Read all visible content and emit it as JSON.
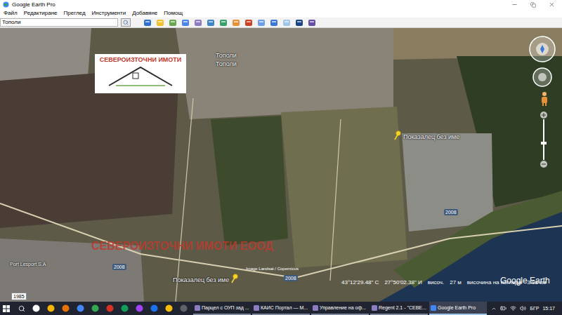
{
  "window": {
    "title": "Google Earth Pro"
  },
  "menu": [
    {
      "label": "Файл"
    },
    {
      "label": "Редактиране"
    },
    {
      "label": "Преглед"
    },
    {
      "label": "Инструменти"
    },
    {
      "label": "Добавяне"
    },
    {
      "label": "Помощ"
    }
  ],
  "search": {
    "value": "Тополи"
  },
  "map": {
    "logo": {
      "text": "СЕВЕРОИЗТОЧНИ ИМОТИ"
    },
    "place_labels": [
      {
        "text": "Тополи"
      },
      {
        "text": "Тополи"
      }
    ],
    "placemarks": [
      {
        "label": "Показалец без име"
      },
      {
        "label": "Показалец без име"
      }
    ],
    "road_labels": [
      {
        "text": "2008"
      },
      {
        "text": "2008"
      },
      {
        "text": "2008"
      }
    ],
    "watermark": "СЕВЕРОИЗТОЧНИ ИМОТИ ЕООД",
    "poi": "Port Lesport S.A",
    "attribution": "Image Landsat / Copernicus",
    "brand": "Google Earth",
    "historic_year": "1985"
  },
  "status_bar": {
    "latitude": "43°12'29.48\" С",
    "longitude": "27°50'02.38\" И",
    "elevation_label": "височ.",
    "elevation": "27 м",
    "eye_label": "височина на погледа",
    "eye": "3.98 км"
  },
  "taskbar": {
    "apps": [
      {
        "label": "Парцел с ОУП зад ...",
        "selected": false
      },
      {
        "label": "КАИС Портал — M...",
        "selected": false
      },
      {
        "label": "Управление на оф...",
        "selected": false
      },
      {
        "label": "Regent 2.1 - \"СЕВЕ...",
        "selected": false
      },
      {
        "label": "Google Earth Pro",
        "selected": true
      }
    ],
    "language": "БГР",
    "time": "15:17"
  }
}
